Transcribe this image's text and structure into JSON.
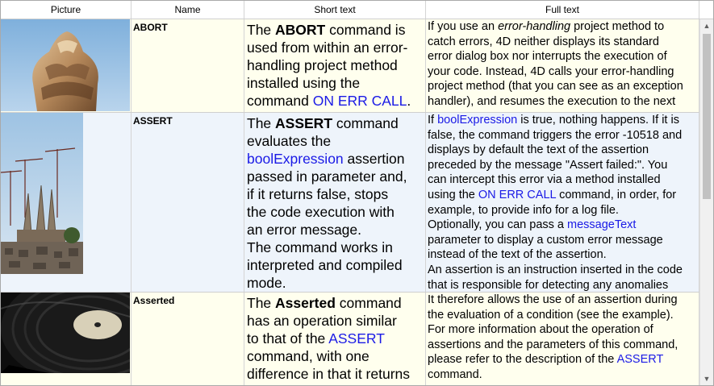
{
  "headers": {
    "picture": "Picture",
    "name": "Name",
    "short": "Short text",
    "full": "Full text"
  },
  "rows": [
    {
      "name": "ABORT",
      "short": [
        [
          {
            "t": "The "
          },
          {
            "t": "ABORT",
            "b": true
          },
          {
            "t": " command is"
          }
        ],
        [
          {
            "t": "used from within an error-"
          }
        ],
        [
          {
            "t": "handling project method"
          }
        ],
        [
          {
            "t": "installed using the"
          }
        ],
        [
          {
            "t": "command "
          },
          {
            "t": "ON ERR CALL",
            "l": true
          },
          {
            "t": "."
          }
        ]
      ],
      "full": [
        [
          {
            "t": "If you use an "
          },
          {
            "t": "error-handling",
            "i": true
          },
          {
            "t": " project method to"
          }
        ],
        [
          {
            "t": "catch errors, 4D neither displays its standard"
          }
        ],
        [
          {
            "t": "error dialog box nor interrupts the execution of"
          }
        ],
        [
          {
            "t": "your code. Instead, 4D calls your error-handling"
          }
        ],
        [
          {
            "t": "project method (that you can see as an exception"
          }
        ],
        [
          {
            "t": "handler), and resumes the execution to the next"
          }
        ]
      ]
    },
    {
      "name": "ASSERT",
      "short": [
        [
          {
            "t": "The "
          },
          {
            "t": "ASSERT",
            "b": true
          },
          {
            "t": " command"
          }
        ],
        [
          {
            "t": "evaluates the"
          }
        ],
        [
          {
            "t": "boolExpression",
            "l": true
          },
          {
            "t": " assertion"
          }
        ],
        [
          {
            "t": "passed in parameter and,"
          }
        ],
        [
          {
            "t": "if it returns false, stops"
          }
        ],
        [
          {
            "t": "the code execution with"
          }
        ],
        [
          {
            "t": "an error message."
          }
        ],
        [
          {
            "t": "The command works in"
          }
        ],
        [
          {
            "t": "interpreted and compiled"
          }
        ],
        [
          {
            "t": "mode."
          }
        ]
      ],
      "full": [
        [
          {
            "t": "If "
          },
          {
            "t": "boolExpression",
            "l": true
          },
          {
            "t": " is true, nothing happens. If it is"
          }
        ],
        [
          {
            "t": "false, the command triggers the error -10518 and"
          }
        ],
        [
          {
            "t": "displays by default the text of the assertion"
          }
        ],
        [
          {
            "t": "preceded by the message \"Assert failed:\". You"
          }
        ],
        [
          {
            "t": "can intercept this error via a method installed"
          }
        ],
        [
          {
            "t": "using the "
          },
          {
            "t": "ON ERR CALL",
            "l": true
          },
          {
            "t": " command, in order, for"
          }
        ],
        [
          {
            "t": "example, to provide info for a log file."
          }
        ],
        [
          {
            "t": "Optionally, you can pass a "
          },
          {
            "t": "messageText",
            "l": true
          }
        ],
        [
          {
            "t": "parameter to display a custom error message"
          }
        ],
        [
          {
            "t": "instead of the text of the assertion."
          }
        ],
        [
          {
            "t": "An assertion is an instruction inserted in the code"
          }
        ],
        [
          {
            "t": "that is responsible for detecting any anomalies"
          }
        ]
      ]
    },
    {
      "name": "Asserted",
      "short": [
        [
          {
            "t": "The "
          },
          {
            "t": "Asserted",
            "b": true
          },
          {
            "t": " command"
          }
        ],
        [
          {
            "t": "has an operation similar"
          }
        ],
        [
          {
            "t": "to that of the "
          },
          {
            "t": "ASSERT",
            "l": true
          }
        ],
        [
          {
            "t": "command, with one"
          }
        ],
        [
          {
            "t": "difference in that it returns"
          }
        ]
      ],
      "full": [
        [
          {
            "t": "It therefore allows the use of an assertion during"
          }
        ],
        [
          {
            "t": "the evaluation of a condition (see the example)."
          }
        ],
        [
          {
            "t": "For more information about the operation of"
          }
        ],
        [
          {
            "t": "assertions and the parameters of this command,"
          }
        ],
        [
          {
            "t": "please refer to the description of the "
          },
          {
            "t": "ASSERT",
            "l": true
          }
        ],
        [
          {
            "t": "command."
          }
        ]
      ]
    }
  ],
  "colors": {
    "link": "#1a1ae6",
    "row_odd": "#ffffee",
    "row_even": "#eef4fb"
  },
  "icons": {
    "scroll_up": "scroll-up-arrow-icon",
    "scroll_down": "scroll-down-arrow-icon"
  }
}
